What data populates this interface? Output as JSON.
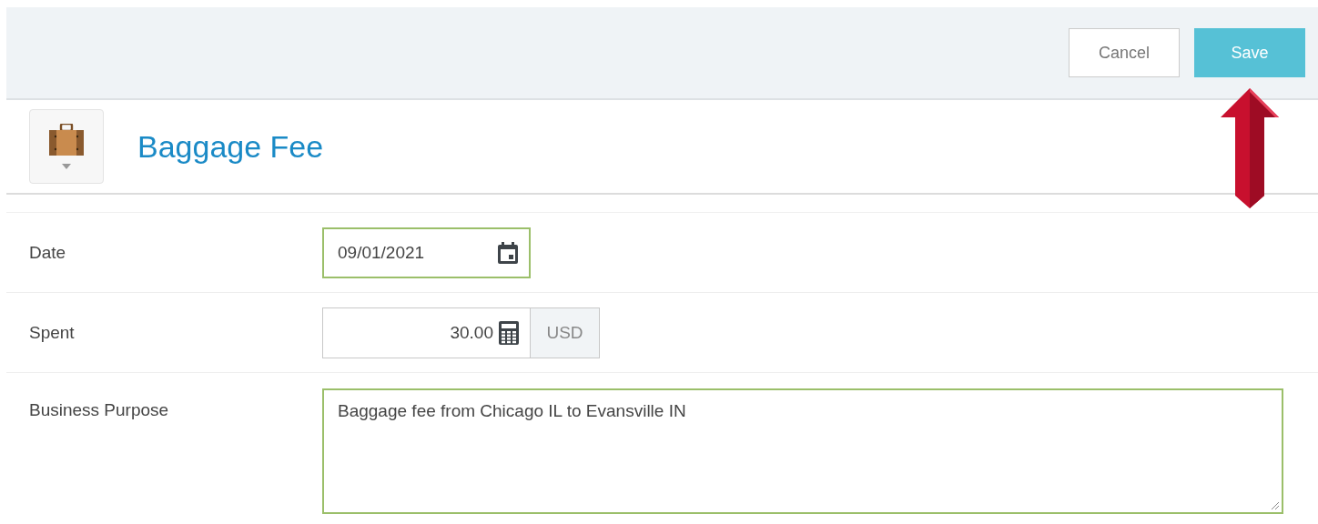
{
  "toolbar": {
    "buttons": [
      {
        "label": "Cancel",
        "kind": "secondary"
      },
      {
        "label": "Save",
        "kind": "primary"
      }
    ]
  },
  "header": {
    "title": "Baggage Fee"
  },
  "fields": [
    {
      "label": "Date",
      "kind": "date",
      "value": "09/01/2021",
      "validated": true
    },
    {
      "label": "Spent",
      "kind": "amount",
      "value": "30.00",
      "currency": "USD",
      "validated": false
    },
    {
      "label": "Business Purpose",
      "kind": "textarea",
      "value": "Baggage fee from Chicago IL to Evansville IN",
      "validated": true
    }
  ]
}
